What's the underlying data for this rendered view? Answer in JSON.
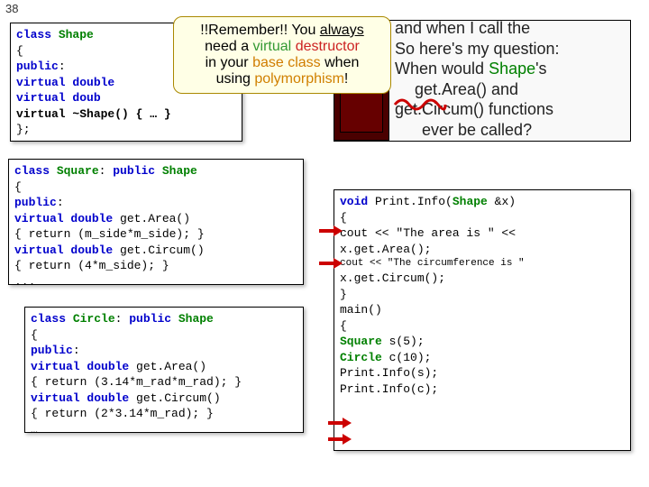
{
  "slide_number": "38",
  "callout": {
    "line1a": "!!Remember!! You ",
    "line1b": "always",
    "line2a": "need a ",
    "line2b": "virtual",
    "line2c": " ",
    "line2d": "destructor",
    "line3a": "in your ",
    "line3b": "base class",
    "line3c": " when",
    "line4a": "using ",
    "line4b": "polymorphism",
    "line4c": "!"
  },
  "question": {
    "frag1": " and when I call the",
    "frag2": "So here's my question:",
    "frag3": "When would ",
    "shape_word": "Shape",
    "frag3b": "'s",
    "frag4": "get.Area() and",
    "frag5": "get.Circum() functions",
    "frag6": "ever be called?"
  },
  "shape_code": {
    "l1a": "class ",
    "l1b": "Shape",
    "l2": "{",
    "l3a": "public",
    "l3b": ":",
    "l4a": "  virtual double",
    "l5a": "  virtual doub ",
    "l6": "  virtual ~Shape() { … }",
    "l7": "};"
  },
  "square_code": {
    "l1a": "class ",
    "l1b": "Square",
    "l1c": ": ",
    "l1d": "public ",
    "l1e": "Shape",
    "l2": "{",
    "l3a": "public",
    "l3b": ":",
    "l4a": "  virtual double",
    "l4b": " get.Area()",
    "l5": "    { return (m_side*m_side); }",
    "l6a": "  virtual double",
    "l6b": " get.Circum()",
    "l7": "    { return (4*m_side); }",
    "l8": "  ..."
  },
  "circle_code": {
    "l1a": "class ",
    "l1b": "Circle",
    "l1c": ": ",
    "l1d": "public ",
    "l1e": "Shape",
    "l2": "{",
    "l3a": "public",
    "l3b": ":",
    "l4a": "  virtual double",
    "l4b": " get.Area()",
    "l5": "    { return (3.14*m_rad*m_rad); }",
    "l6a": "  virtual double",
    "l6b": " get.Circum()",
    "l7": "    { return (2*3.14*m_rad); }",
    "l8": "  …"
  },
  "right_code": {
    "l1a": "void",
    "l1b": " Print.Info(",
    "l1c": "Shape",
    "l1d": " &x)",
    "l2": "{",
    "l3": " cout << \"The area is \" <<",
    "l4": "   x.get.Area();",
    "l5": " cout << \"The circumference is \"",
    "l6": "   x.get.Circum();",
    "l7": "}",
    "l8": "",
    "l9": "main()",
    "l10": "{",
    "l11a": "  ",
    "l11b": "Square",
    "l11c": " s(5);",
    "l12a": "  ",
    "l12b": "Circle",
    "l12c": " c(10);",
    "l13": "",
    "l14": "  Print.Info(s);",
    "l15": "  Print.Info(c);"
  }
}
